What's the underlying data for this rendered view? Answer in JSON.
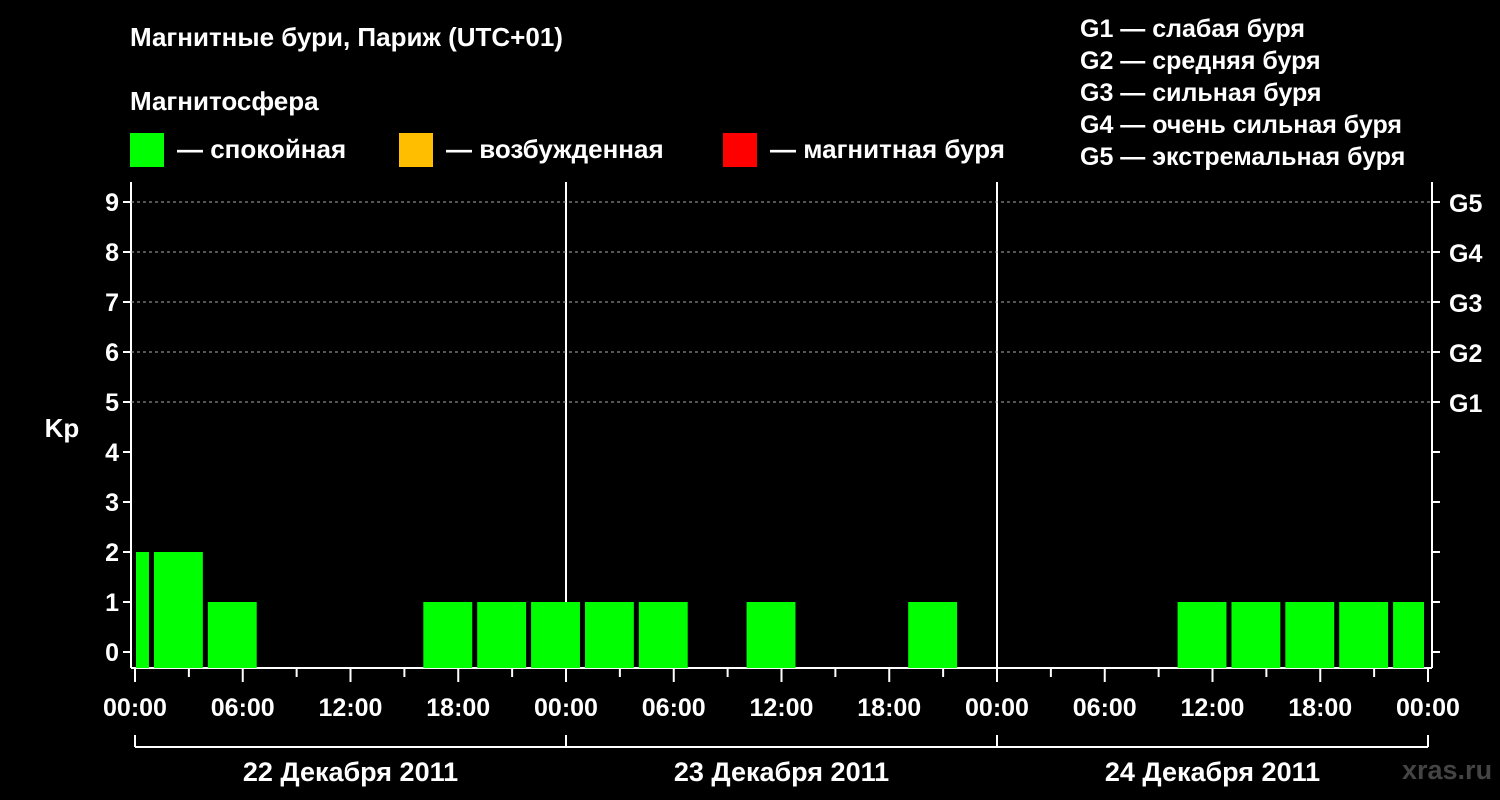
{
  "title": "Магнитные бури, Париж (UTC+01)",
  "legend": {
    "heading": "Магнитосфера",
    "items": [
      {
        "label": "— спокойная",
        "color": "#00ff00"
      },
      {
        "label": "— возбужденная",
        "color": "#ffbf00"
      },
      {
        "label": "— магнитная буря",
        "color": "#ff0000"
      }
    ],
    "g_levels": [
      "G1 — слабая буря",
      "G2 — средняя буря",
      "G3 — сильная буря",
      "G4 — очень сильная буря",
      "G5 — экстремальная буря"
    ]
  },
  "watermark": "xras.ru",
  "chart_data": {
    "type": "bar",
    "ylabel": "Kp",
    "ylim": [
      0,
      9
    ],
    "y_ticks": [
      "0",
      "1",
      "2",
      "3",
      "4",
      "5",
      "6",
      "7",
      "8",
      "9"
    ],
    "right_ticks": [
      {
        "kp": 5,
        "label": "G1"
      },
      {
        "kp": 6,
        "label": "G2"
      },
      {
        "kp": 7,
        "label": "G3"
      },
      {
        "kp": 8,
        "label": "G4"
      },
      {
        "kp": 9,
        "label": "G5"
      }
    ],
    "x_tick_labels": [
      "00:00",
      "06:00",
      "12:00",
      "18:00",
      "00:00",
      "06:00",
      "12:00",
      "18:00",
      "00:00",
      "06:00",
      "12:00",
      "18:00",
      "00:00"
    ],
    "days": [
      "22 Декабря 2011",
      "23 Декабря 2011",
      "24 Декабря 2011"
    ],
    "grid": "dashed horizontal",
    "bars": [
      {
        "start_hour": 0,
        "end_hour": 1,
        "kp": 2
      },
      {
        "start_hour": 1,
        "end_hour": 4,
        "kp": 2
      },
      {
        "start_hour": 4,
        "end_hour": 7,
        "kp": 1
      },
      {
        "start_hour": 7,
        "end_hour": 10,
        "kp": 0
      },
      {
        "start_hour": 10,
        "end_hour": 13,
        "kp": 0
      },
      {
        "start_hour": 13,
        "end_hour": 16,
        "kp": 0
      },
      {
        "start_hour": 16,
        "end_hour": 19,
        "kp": 1
      },
      {
        "start_hour": 19,
        "end_hour": 22,
        "kp": 1
      },
      {
        "start_hour": 22,
        "end_hour": 25,
        "kp": 1
      },
      {
        "start_hour": 25,
        "end_hour": 28,
        "kp": 1
      },
      {
        "start_hour": 28,
        "end_hour": 31,
        "kp": 1
      },
      {
        "start_hour": 31,
        "end_hour": 34,
        "kp": 0
      },
      {
        "start_hour": 34,
        "end_hour": 37,
        "kp": 1
      },
      {
        "start_hour": 37,
        "end_hour": 40,
        "kp": 0
      },
      {
        "start_hour": 40,
        "end_hour": 43,
        "kp": 0
      },
      {
        "start_hour": 43,
        "end_hour": 46,
        "kp": 1
      },
      {
        "start_hour": 46,
        "end_hour": 49,
        "kp": 0
      },
      {
        "start_hour": 49,
        "end_hour": 52,
        "kp": 0
      },
      {
        "start_hour": 52,
        "end_hour": 55,
        "kp": 0
      },
      {
        "start_hour": 55,
        "end_hour": 58,
        "kp": 0
      },
      {
        "start_hour": 58,
        "end_hour": 61,
        "kp": 1
      },
      {
        "start_hour": 61,
        "end_hour": 64,
        "kp": 1
      },
      {
        "start_hour": 64,
        "end_hour": 67,
        "kp": 1
      },
      {
        "start_hour": 67,
        "end_hour": 70,
        "kp": 1
      },
      {
        "start_hour": 70,
        "end_hour": 72,
        "kp": 1
      }
    ]
  }
}
